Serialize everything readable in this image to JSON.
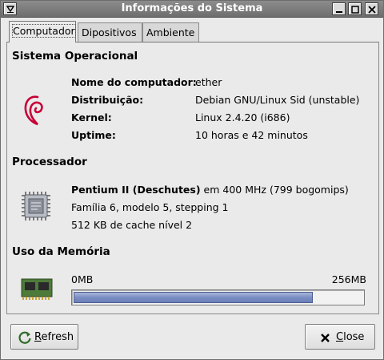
{
  "window": {
    "title": "Informações do Sistema"
  },
  "tabs": [
    {
      "label": "Computador"
    },
    {
      "label": "Dipositivos"
    },
    {
      "label": "Ambiente"
    }
  ],
  "os_section": {
    "title": "Sistema Operacional",
    "icon": "debian-swirl-icon",
    "rows": [
      {
        "key": "Nome do computador:",
        "value": "ether"
      },
      {
        "key": "Distribuição:",
        "value": "Debian GNU/Linux Sid (unstable)"
      },
      {
        "key": "Kernel:",
        "value": "Linux 2.4.20 (i686)"
      },
      {
        "key": "Uptime:",
        "value": "10 horas e 42 minutos"
      }
    ]
  },
  "cpu_section": {
    "title": "Processador",
    "icon": "cpu-chip-icon",
    "model": "Pentium II (Deschutes)",
    "speed": "em 400 MHz (799 bogomips)",
    "family": "Família 6, modelo 5, stepping 1",
    "cache": "512 KB de cache nível 2"
  },
  "memory_section": {
    "title": "Uso da Memória",
    "icon": "memory-module-icon",
    "min_label": "0MB",
    "max_label": "256MB",
    "used_fraction": 0.83
  },
  "buttons": {
    "refresh_pre": "",
    "refresh_mnemonic": "R",
    "refresh_rest": "efresh",
    "close_mnemonic": "C",
    "close_rest": "lose"
  },
  "colors": {
    "titlebar": "#7a7a7a",
    "progress_fill": "#7b8ec4",
    "debian_red": "#c70036"
  }
}
